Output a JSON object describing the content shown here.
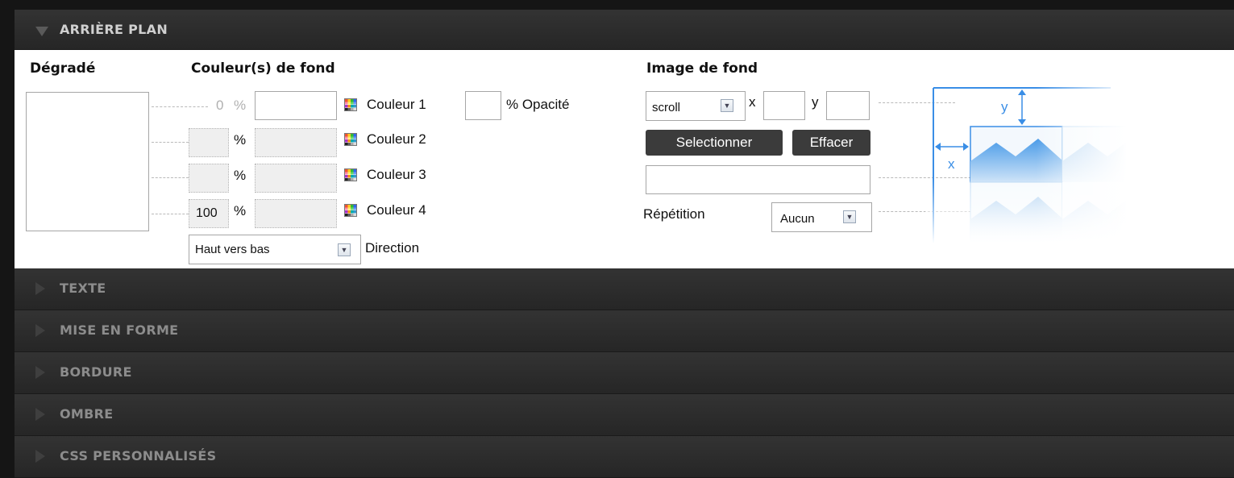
{
  "sections": {
    "background": {
      "title": "ARRIÈRE PLAN"
    },
    "collapsed": [
      "TEXTE",
      "MISE EN FORME",
      "BORDURE",
      "OMBRE",
      "CSS PERSONNALISÉS"
    ]
  },
  "gradient": {
    "heading": "Dégradé",
    "stops": [
      {
        "position": "0",
        "unit": "%",
        "label": "Couleur 1",
        "enabled": true
      },
      {
        "position": "",
        "unit": "%",
        "label": "Couleur 2",
        "enabled": false
      },
      {
        "position": "",
        "unit": "%",
        "label": "Couleur 3",
        "enabled": false
      },
      {
        "position": "100",
        "unit": "%",
        "label": "Couleur 4",
        "enabled": false
      }
    ],
    "opacity_suffix": "% Opacité",
    "direction": {
      "selected": "Haut vers bas",
      "label": "Direction"
    }
  },
  "colors": {
    "heading": "Couleur(s) de fond"
  },
  "image": {
    "heading": "Image de fond",
    "attachment": "scroll",
    "x_label": "x",
    "y_label": "y",
    "select_button": "Selectionner",
    "clear_button": "Effacer",
    "repeat_label": "Répétition",
    "repeat_value": "Aucun"
  },
  "diagram": {
    "x_label": "x",
    "y_label": "y"
  },
  "theme": {
    "header_bg": "#2b2b2b",
    "panel_bg": "#ffffff",
    "accent": "#3a8ee6"
  },
  "icons": [
    "triangle-down-icon",
    "triangle-right-icon",
    "color-palette-icon",
    "chevron-down-icon"
  ]
}
